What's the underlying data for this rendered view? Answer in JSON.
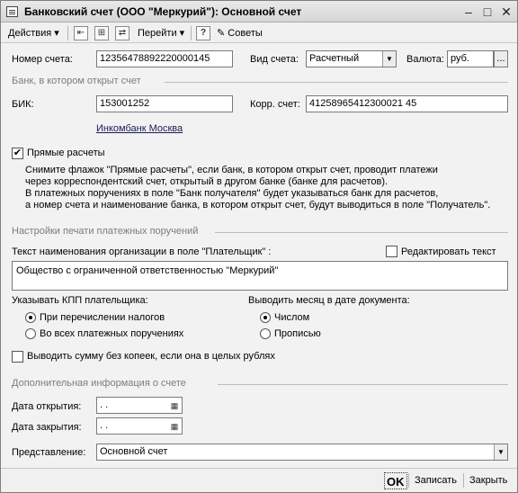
{
  "window": {
    "title": "Банковский счет (ООО \"Меркурий\"): Основной счет"
  },
  "toolbar": {
    "actions": "Действия",
    "goto": "Перейти",
    "help": "?",
    "tips": "Советы"
  },
  "account": {
    "number_label": "Номер счета:",
    "number_value": "12356478892220000145",
    "type_label": "Вид счета:",
    "type_value": "Расчетный",
    "currency_label": "Валюта:",
    "currency_value": "руб.",
    "currency_button": "..."
  },
  "bank": {
    "section_title": "Банк, в котором открыт счет",
    "bik_label": "БИК:",
    "bik_value": "153001252",
    "corr_label": "Корр. счет:",
    "corr_value": "41258965412300021 45",
    "bank_name": "Инкомбанк Москва"
  },
  "direct": {
    "label": "Прямые расчеты",
    "note": [
      "Снимите флажок \"Прямые расчеты\", если банк, в котором открыт счет, проводит платежи",
      "через корреспондентский счет, открытый в другом банке (банке для расчетов).",
      "В платежных поручениях в поле \"Банк получателя\" будет указываться банк для расчетов,",
      "а номер счета и наименование банка, в котором открыт счет, будут выводиться в поле \"Получатель\"."
    ]
  },
  "print": {
    "section_title": "Настройки печати платежных поручений",
    "payer_text_label": "Текст наименования организации в поле \"Плательщик\" :",
    "edit_text_label": "Редактировать текст",
    "payer_text": "Общество с ограниченной ответственностью \"Меркурий\"",
    "kpp_label": "Указывать КПП плательщика:",
    "kpp_opt1": "При перечислении налогов",
    "kpp_opt2": "Во всех платежных поручениях",
    "month_label": "Выводить месяц в дате документа:",
    "month_opt1": "Числом",
    "month_opt2": "Прописью",
    "no_kopecks_label": "Выводить сумму без копеек, если она в целых рублях"
  },
  "extra": {
    "section_title": "Дополнительная информация о счете",
    "open_label": "Дата открытия:",
    "open_value": " .  .",
    "close_label": "Дата закрытия:",
    "close_value": " .  .",
    "repr_label": "Представление:",
    "repr_value": "Основной счет"
  },
  "buttons": {
    "ok": "OK",
    "save": "Записать",
    "close": "Закрыть"
  }
}
